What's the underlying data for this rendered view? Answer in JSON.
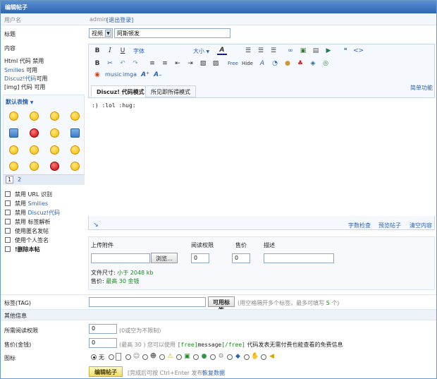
{
  "header": {
    "title": "编辑帖子"
  },
  "user": {
    "label": "用户名",
    "name": "admin",
    "logout": "[退出登录]"
  },
  "subject": {
    "label": "标题",
    "type_value": "视频",
    "value": "阿斯顿发"
  },
  "content": {
    "label": "内容"
  },
  "rules": {
    "html_prefix": "Html 代码",
    "html_state": "禁用",
    "smilies_link": "Smilies",
    "smilies_state": "可用",
    "discuz_link": "Discuz!代码",
    "discuz_state": "可用",
    "img_prefix": "[img] 代码",
    "img_state": "可用"
  },
  "smilies": {
    "title": "默认表情",
    "pages": [
      "1",
      "2"
    ]
  },
  "options": [
    {
      "prefix": "禁用",
      "text": "URL 识别",
      "link": ""
    },
    {
      "prefix": "禁用",
      "text": "",
      "link": "Smilies"
    },
    {
      "prefix": "禁用",
      "text": "",
      "link": "Discuz!代码"
    },
    {
      "prefix": "禁用",
      "text": "标签解析",
      "link": ""
    },
    {
      "prefix": "",
      "text": "使用匿名发帖",
      "link": ""
    },
    {
      "prefix": "",
      "text": "使用个人签名",
      "link": ""
    },
    {
      "prefix": "",
      "text": "!删除本帖",
      "link": ""
    }
  ],
  "editor": {
    "font_label": "字体",
    "size_label": "大小",
    "music": "music",
    "imga": "imga",
    "tab_code": "Discuz! 代码模式",
    "tab_wysiwyg": "所见即所得模式",
    "simple": "简单功能",
    "text": ":) :lol :hug:",
    "count": "字数检查",
    "preview": "预览帖子",
    "clear": "清空内容"
  },
  "attach": {
    "col_file": "上传附件",
    "col_perm": "阅读权限",
    "col_price": "售价",
    "col_desc": "描述",
    "browse": "浏览...",
    "perm_value": "0",
    "price_value": "0",
    "size_prefix": "文件尺寸:",
    "size_value": "小于 2048 kb",
    "price_prefix": "售价:",
    "price_text": "最高 30 金钱"
  },
  "tags": {
    "label": "标签(TAG)",
    "button": "可用标签",
    "hint_a": "(用空格隔开多个标签，最多可填写",
    "hint_num": "5",
    "hint_b": "个)"
  },
  "other": {
    "label": "其他信息"
  },
  "readperm": {
    "label": "所需阅读权限",
    "value": "0",
    "hint": "(0或空为不限制)"
  },
  "price": {
    "label": "售价(金钱)",
    "value": "0",
    "hint_a": "(最高 30 ) 您可以使用",
    "code_open": "[free]",
    "code_mid": "message",
    "code_close": "[/free]",
    "hint_b": "代码发表无需付费也能查看的免费信息"
  },
  "icons": {
    "label": "图标",
    "none": "无"
  },
  "submit": {
    "button": "编辑帖子",
    "hint": "[完成后可按 Ctrl+Enter 发布]",
    "restore": "恢复数据"
  }
}
